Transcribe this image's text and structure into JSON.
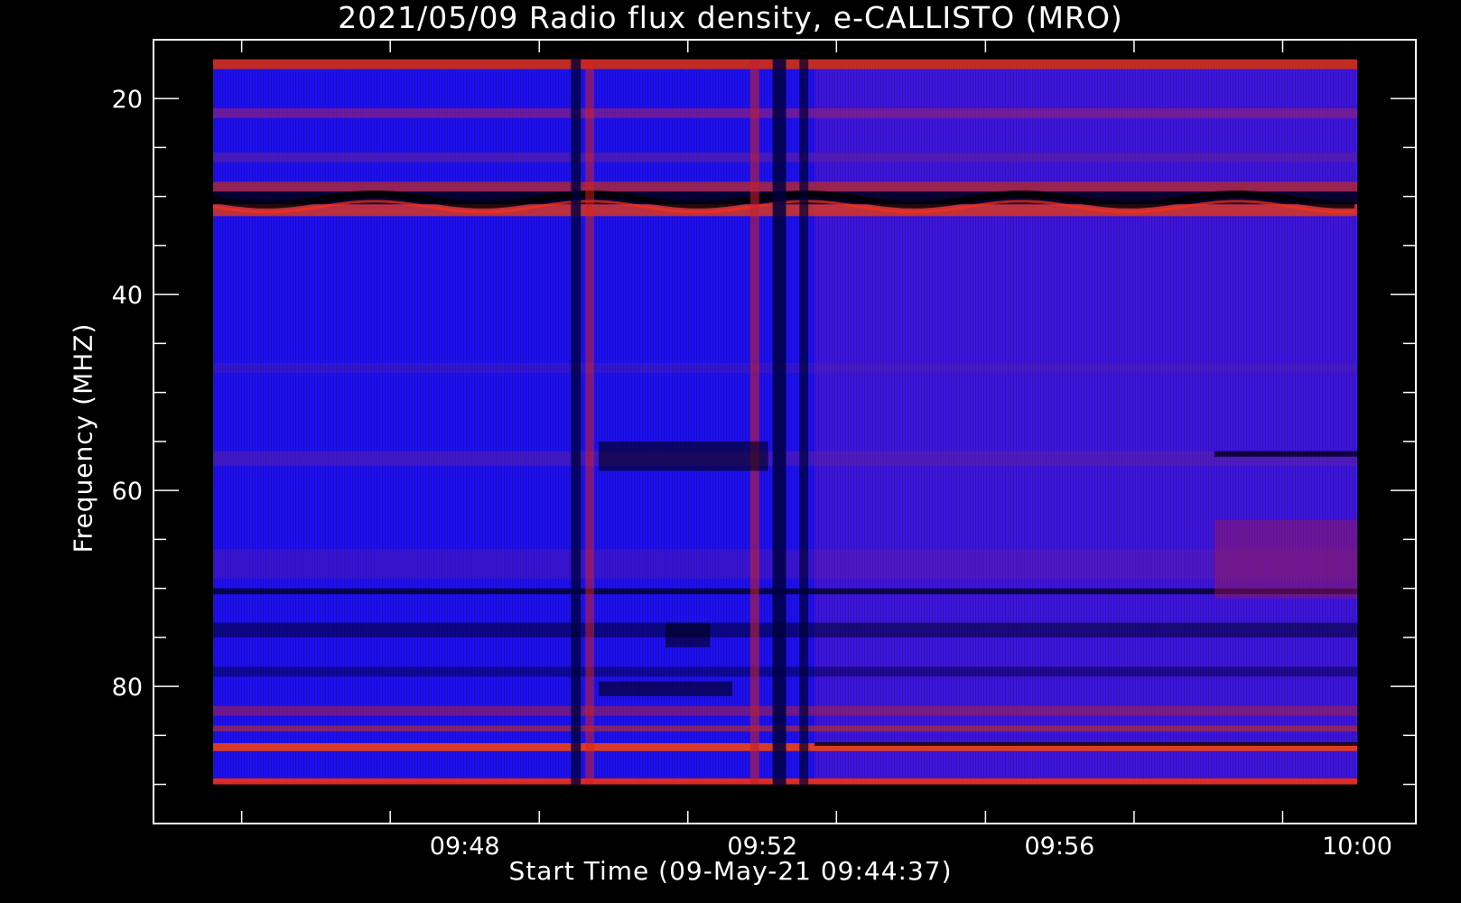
{
  "chart_data": {
    "type": "heatmap",
    "title": "2021/05/09  Radio flux density, e-CALLISTO (MRO)",
    "xlabel": "Start Time (09-May-21 09:44:37)",
    "ylabel": "Frequency (MHZ)",
    "x_tick_labels": [
      "09:48",
      "09:52",
      "09:56",
      "10:00"
    ],
    "y_tick_labels": [
      "20",
      "40",
      "60",
      "80"
    ],
    "x_ticks_min": [
      9.75,
      9.7833,
      9.8167,
      9.85,
      9.8833,
      9.9167,
      9.95,
      9.9833,
      10.0167,
      10.05,
      10.0833,
      10.1167,
      10.15,
      10.1833,
      10.2167,
      10.25,
      10.2833,
      10.3167
    ],
    "x_major_hours": [
      9.8,
      9.8667,
      9.9333,
      10.0
    ],
    "x_range_hours": [
      9.7436,
      10.0
    ],
    "y_ticks_minor": [
      25,
      30,
      35,
      45,
      50,
      55,
      65,
      70,
      75,
      85,
      90
    ],
    "y_ticks_major": [
      20,
      40,
      60,
      80
    ],
    "ylim": [
      14,
      94
    ],
    "y_inverted": true,
    "data_freq_range": [
      16,
      90
    ],
    "colormap": [
      "#000000",
      "#0000ff",
      "#ff0000",
      "#ffff00"
    ],
    "background_color": "#000000",
    "grid": false
  }
}
